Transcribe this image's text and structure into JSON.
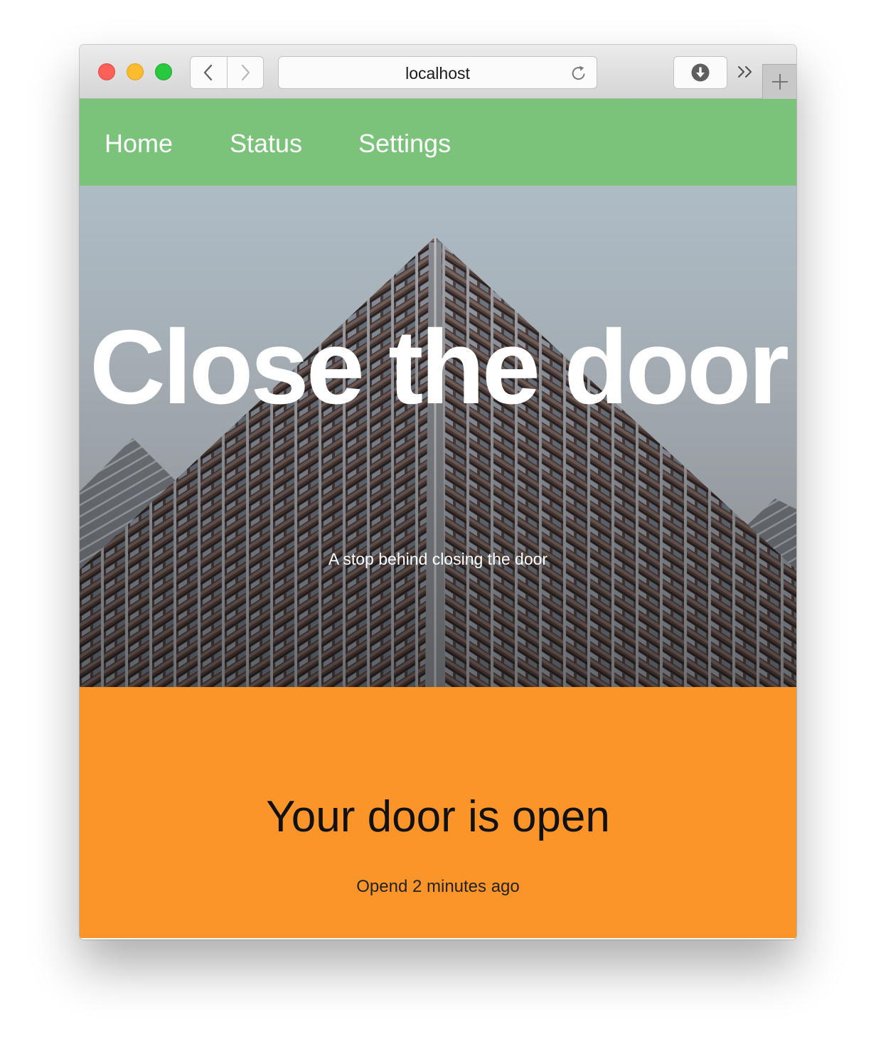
{
  "browser": {
    "url": "localhost",
    "buttons": {
      "close": "close",
      "minimize": "minimize",
      "zoom": "zoom"
    }
  },
  "nav": {
    "items": [
      {
        "label": "Home"
      },
      {
        "label": "Status"
      },
      {
        "label": "Settings"
      }
    ]
  },
  "hero": {
    "title": "Close the door",
    "subtitle": "A stop behind closing the door"
  },
  "status": {
    "heading": "Your door is open",
    "time": "Opend 2 minutes ago"
  },
  "icons": {
    "back": "chevron-left-icon",
    "forward": "chevron-right-icon",
    "reload": "reload-icon",
    "download": "download-icon",
    "overflow": "double-chevron-right-icon",
    "new_tab": "plus-icon"
  },
  "colors": {
    "navbar": "#7bc27b",
    "status_panel": "#fc9529",
    "traffic_close": "#fc5f57",
    "traffic_minimize": "#fdbc2e",
    "traffic_zoom": "#28c83f"
  }
}
